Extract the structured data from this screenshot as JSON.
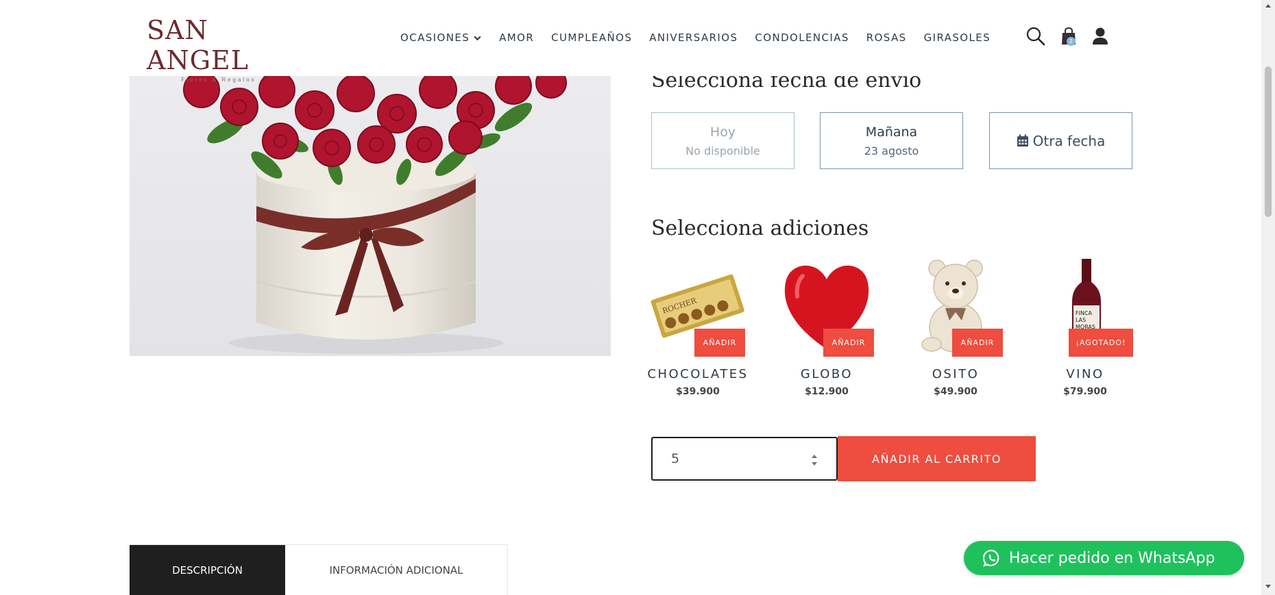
{
  "brand": {
    "name": "SAN ANGEL",
    "tagline": "Flores & Regalos"
  },
  "nav": {
    "items": [
      {
        "label": "OCASIONES"
      },
      {
        "label": "AMOR"
      },
      {
        "label": "CUMPLEAÑOS"
      },
      {
        "label": "ANIVERSARIOS"
      },
      {
        "label": "CONDOLENCIAS"
      },
      {
        "label": "ROSAS"
      },
      {
        "label": "GIRASOLES"
      }
    ],
    "cart_count": "2",
    "icons": [
      "search-icon",
      "cart-icon",
      "user-icon"
    ]
  },
  "delivery": {
    "title": "Selecciona fecha de envío",
    "options": [
      {
        "label": "Hoy",
        "sub": "No disponible",
        "disabled": true
      },
      {
        "label": "Mañana",
        "sub": "23 agosto",
        "disabled": false
      },
      {
        "label": "Otra fecha",
        "icon": "calendar-icon",
        "disabled": false
      }
    ]
  },
  "additions": {
    "title": "Selecciona adiciones",
    "items": [
      {
        "name": "CHOCOLATES",
        "price": "$39.900",
        "button": "AÑADIR"
      },
      {
        "name": "GLOBO",
        "price": "$12.900",
        "button": "AÑADIR"
      },
      {
        "name": "OSITO",
        "price": "$49.900",
        "button": "AÑADIR"
      },
      {
        "name": "VINO",
        "price": "$79.900",
        "button": "¡AGOTADO!"
      }
    ]
  },
  "cart": {
    "quantity": "5",
    "add_label": "AÑADIR AL CARRITO"
  },
  "tabs": [
    {
      "label": "DESCRIPCIÓN",
      "active": true
    },
    {
      "label": "INFORMACIÓN ADICIONAL",
      "active": false
    }
  ],
  "whatsapp": {
    "label": "Hacer pedido en WhatsApp"
  },
  "colors": {
    "accent": "#ee4d3f",
    "brand": "#6b2b30",
    "whatsapp": "#1fc15d",
    "tab_active": "#1f1f1f"
  }
}
